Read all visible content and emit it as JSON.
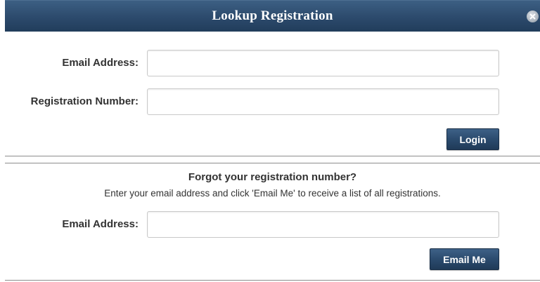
{
  "dialog": {
    "title": "Lookup Registration",
    "close_icon": "close-circle-icon"
  },
  "login_section": {
    "email_label": "Email Address:",
    "email_value": "",
    "registration_label": "Registration Number:",
    "registration_value": "",
    "login_button": "Login"
  },
  "forgot_section": {
    "heading": "Forgot your registration number?",
    "description": "Enter your email address and click 'Email Me' to receive a list of all registrations.",
    "email_label": "Email Address:",
    "email_value": "",
    "email_me_button": "Email Me"
  },
  "colors": {
    "titlebar": "#2c4a6c",
    "button": "#2b4b6e",
    "label_text": "#333333",
    "divider": "#8c8c8c"
  }
}
